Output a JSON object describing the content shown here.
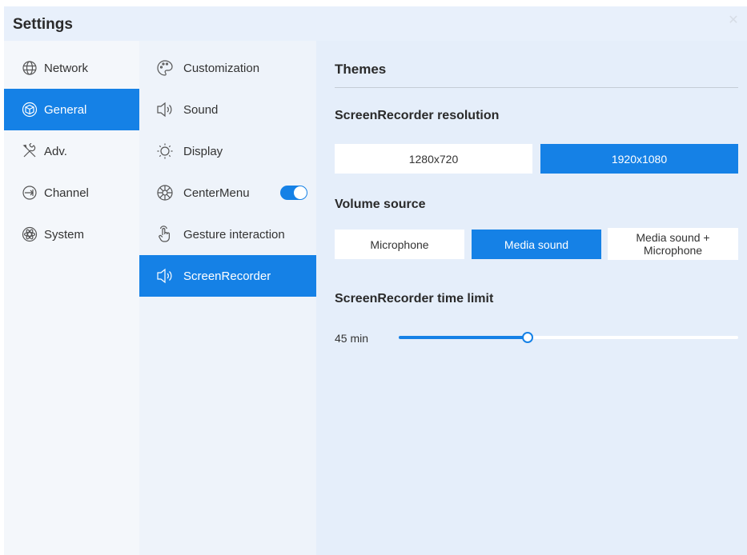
{
  "window": {
    "title": "Settings",
    "close_icon": "close-icon"
  },
  "nav": {
    "items": [
      {
        "label": "Network",
        "icon": "globe-icon",
        "active": false
      },
      {
        "label": "General",
        "icon": "cube-icon",
        "active": true
      },
      {
        "label": "Adv.",
        "icon": "tools-icon",
        "active": false
      },
      {
        "label": "Channel",
        "icon": "input-icon",
        "active": false
      },
      {
        "label": "System",
        "icon": "atom-icon",
        "active": false
      }
    ]
  },
  "submenu": {
    "items": [
      {
        "label": "Customization",
        "icon": "palette-icon",
        "active": false
      },
      {
        "label": "Sound",
        "icon": "speaker-icon",
        "active": false
      },
      {
        "label": "Display",
        "icon": "sun-icon",
        "active": false
      },
      {
        "label": "CenterMenu",
        "icon": "wheel-icon",
        "active": false,
        "toggle": true
      },
      {
        "label": "Gesture interaction",
        "icon": "hand-icon",
        "active": false
      },
      {
        "label": "ScreenRecorder",
        "icon": "speaker-icon",
        "active": true
      }
    ]
  },
  "content": {
    "section_title": "Themes",
    "resolution": {
      "title": "ScreenRecorder resolution",
      "options": [
        "1280x720",
        "1920x1080"
      ],
      "selected": "1920x1080"
    },
    "volume": {
      "title": "Volume source",
      "options": [
        "Microphone",
        "Media sound",
        "Media sound + Microphone"
      ],
      "selected": "Media sound"
    },
    "time_limit": {
      "title": "ScreenRecorder time limit",
      "value_label": "45 min",
      "fill_fraction": 0.38
    }
  },
  "colors": {
    "accent": "#1581e6",
    "sidebar": "#f4f7fb",
    "submenu": "#eef3fa",
    "content": "#e5eefa"
  }
}
